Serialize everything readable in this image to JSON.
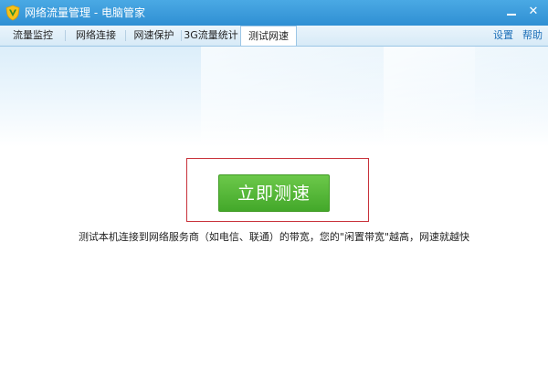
{
  "window": {
    "title": "网络流量管理 - 电脑管家",
    "logo_icon": "shield-v-icon",
    "minimize_icon": "minimize-icon",
    "close_icon": "close-icon",
    "accent_color": "#3a9ad9"
  },
  "tabs": [
    {
      "label": "流量监控"
    },
    {
      "label": "网络连接"
    },
    {
      "label": "网速保护"
    },
    {
      "label": "3G流量统计"
    },
    {
      "label": "测试网速"
    }
  ],
  "active_tab": "测试网速",
  "links": {
    "settings": "设置",
    "help": "帮助"
  },
  "main": {
    "speed_test_button": "立即测速",
    "description": "测试本机连接到网络服务商（如电信、联通）的带宽，您的\"闲置带宽\"越高，网速就越快",
    "button_color": "#4fb336",
    "highlight_color": "#c8323a"
  }
}
